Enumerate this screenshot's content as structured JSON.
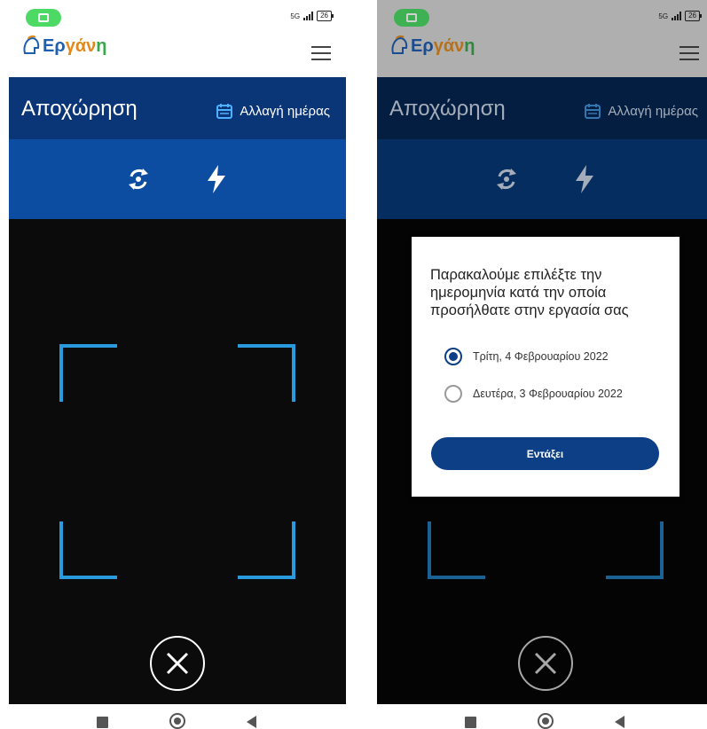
{
  "status_bar": {
    "network": "5G",
    "battery": "26"
  },
  "app": {
    "logo_text_1": "Ερ",
    "logo_text_2": "γάν",
    "logo_text_3": "η"
  },
  "header": {
    "title": "Αποχώρηση",
    "change_day_label": "Αλλαγή ημέρας"
  },
  "icons": {
    "camera": "camera-icon",
    "menu": "hamburger-menu-icon",
    "calendar": "calendar-icon",
    "rotate": "rotate-camera-icon",
    "flash": "flash-icon",
    "close": "close-icon"
  },
  "dialog": {
    "message": "Παρακαλούμε επιλέξτε την ημερομηνία κατά την οποία προσήλθατε στην εργασία σας",
    "options": [
      {
        "label": "Τρίτη, 4 Φεβρουαρίου 2022",
        "selected": true
      },
      {
        "label": "Δευτέρα, 3 Φεβρουαρίου 2022",
        "selected": false
      }
    ],
    "ok_label": "Εντάξει"
  },
  "colors": {
    "title_bar": "#0a3577",
    "toolbar": "#0c4da2",
    "scan_frame": "#2a9adf",
    "dialog_button": "#0c3f86",
    "status_pill": "#4cd964"
  }
}
